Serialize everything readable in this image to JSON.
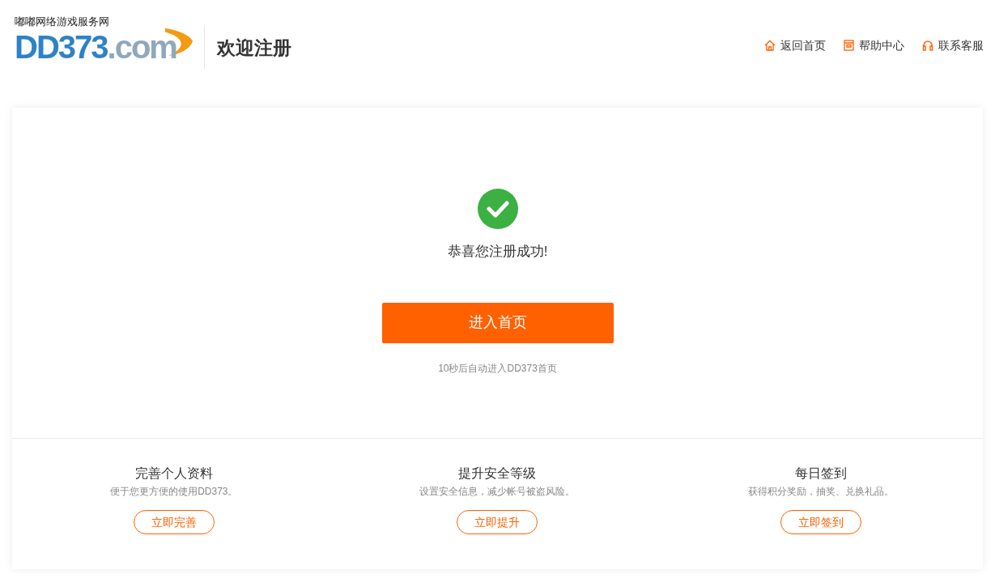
{
  "header": {
    "logo_tagline": "嘟嘟网络游戏服务网",
    "logo_main": "DD373",
    "logo_suffix": ".com",
    "title": "欢迎注册",
    "nav": [
      {
        "kind": "home",
        "label": "返回首页"
      },
      {
        "kind": "help",
        "label": "帮助中心"
      },
      {
        "kind": "service",
        "label": "联系客服"
      }
    ]
  },
  "success": {
    "message": "恭喜您注册成功!",
    "button": "进入首页",
    "hint": "10秒后自动进入DD373首页"
  },
  "features": [
    {
      "title": "完善个人资料",
      "desc": "便于您更方便的使用DD373。",
      "button": "立即完善"
    },
    {
      "title": "提升安全等级",
      "desc": "设置安全信息，减少帐号被盗风险。",
      "button": "立即提升"
    },
    {
      "title": "每日签到",
      "desc": "获得积分奖励，抽奖、兑换礼品。",
      "button": "立即签到"
    }
  ]
}
